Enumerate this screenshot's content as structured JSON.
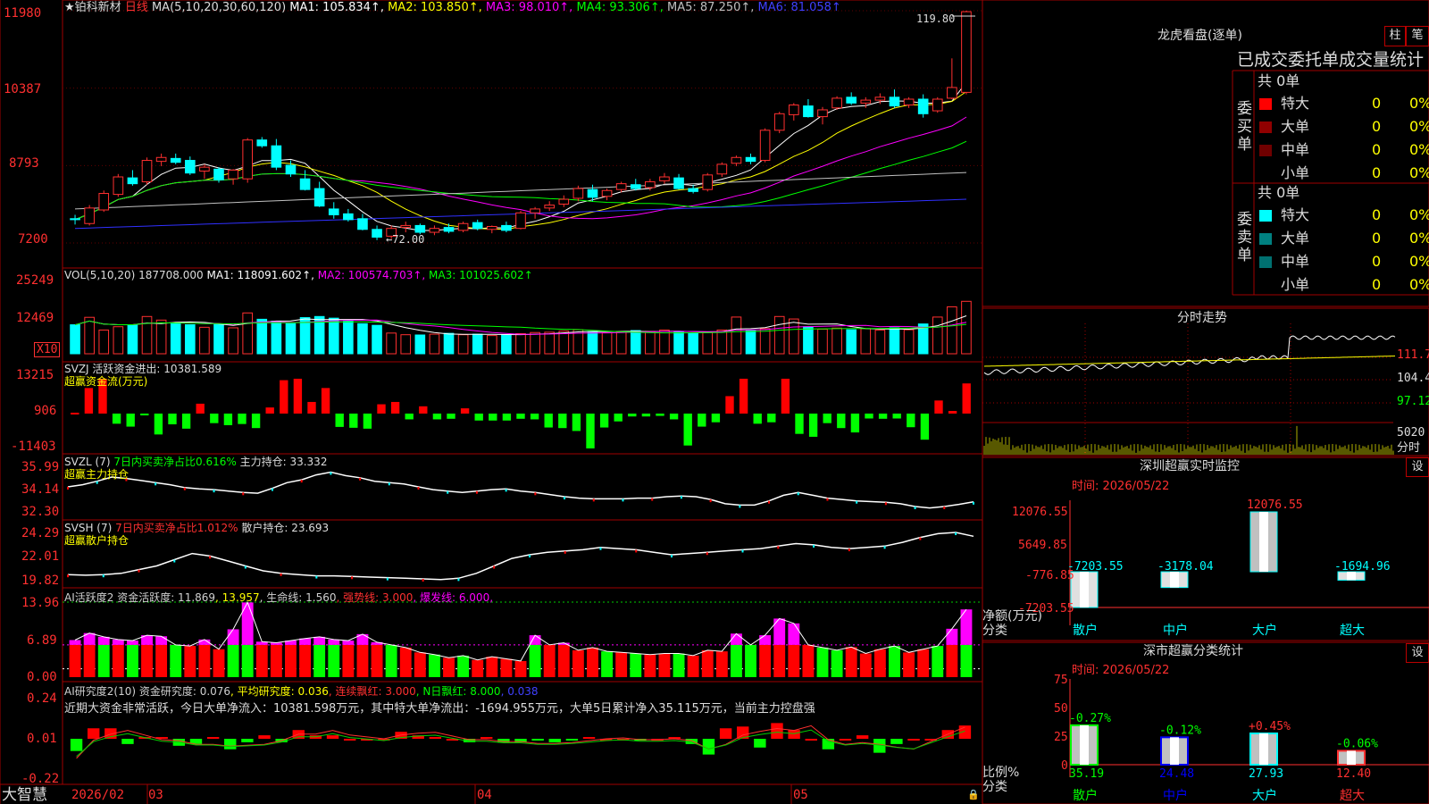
{
  "header": {
    "stock_name": "铂科新材",
    "period": "日线",
    "ma_label": "MA(5,10,20,30,60,120)",
    "ma_values": [
      {
        "text": "MA1: 105.834",
        "color": "#ffffff"
      },
      {
        "text": "MA2: 103.850",
        "color": "#ffff00"
      },
      {
        "text": "MA3: 98.010",
        "color": "#ff00ff"
      },
      {
        "text": "MA4: 93.306",
        "color": "#00ff00"
      },
      {
        "text": "MA5: 87.250",
        "color": "#c0c0c0"
      },
      {
        "text": "MA6: 81.058",
        "color": "#4040ff"
      }
    ],
    "high_marker": "119.80",
    "low_marker": "←72.00"
  },
  "price_axis": [
    "11980",
    "10387",
    "8793",
    "7200"
  ],
  "vol_panel": {
    "label": "VOL(5,10,20)",
    "value": "187708.000",
    "ma": [
      {
        "text": "MA1: 118091.602",
        "color": "#ffffff"
      },
      {
        "text": "MA2: 100574.703",
        "color": "#ff00ff"
      },
      {
        "text": "MA3: 101025.602",
        "color": "#00ff00"
      }
    ],
    "axis": [
      "25249",
      "12469"
    ],
    "unit": "X10"
  },
  "svzj_panel": {
    "label": "SVZJ  活跃资金进出: 10381.589",
    "sub": "超赢资金流(万元)",
    "axis": [
      "13215",
      "906",
      "-11403"
    ]
  },
  "svzl_panel": {
    "label": "SVZL (7)",
    "mid": "7日内买卖净占比0.616%",
    "right": "主力持仓: 33.332",
    "sub": "超赢主力持仓",
    "axis": [
      "35.99",
      "34.14",
      "32.30"
    ]
  },
  "svsh_panel": {
    "label": "SVSH (7)",
    "mid": "7日内买卖净占比1.012%",
    "right": "散户持仓: 23.693",
    "sub": "超赢散户持仓",
    "axis": [
      "24.29",
      "22.01",
      "19.82"
    ]
  },
  "ai_active_panel": {
    "parts": [
      {
        "text": "AI活跃度2 资金活跃度: 11.869",
        "color": "#d0d0d0"
      },
      {
        "text": ", 13.957",
        "color": "#ffff00"
      },
      {
        "text": ", 生命线: 1.560",
        "color": "#d0d0d0"
      },
      {
        "text": ", 强势线: 3.000",
        "color": "#ff3030"
      },
      {
        "text": ", 爆发线: 6.000,",
        "color": "#ff00ff"
      }
    ],
    "axis": [
      "13.96",
      "6.89",
      "0.00"
    ]
  },
  "ai_research_panel": {
    "parts": [
      {
        "text": "AI研究度2(10) 资金研究度: 0.076",
        "color": "#d0d0d0"
      },
      {
        "text": ", 平均研究度: 0.036",
        "color": "#ffff00"
      },
      {
        "text": ", 连续飘红: 3.000",
        "color": "#ff3030"
      },
      {
        "text": ", N日飘红: 8.000",
        "color": "#00ff00"
      },
      {
        "text": ", 0.038",
        "color": "#4040ff"
      }
    ],
    "comment": "近期大资金非常活跃，今日大单净流入：10381.598万元，其中特大单净流出：-1694.955万元，大单5日累计净入35.115万元，当前主力控盘强",
    "axis": [
      "0.24",
      "0.01",
      "-0.22"
    ]
  },
  "bottom_bar": {
    "brand": "大智慧",
    "dates": [
      "2026/02",
      "03",
      "04",
      "05"
    ]
  },
  "right_panel": {
    "title": "龙虎看盘(逐单)",
    "btn_a": "柱",
    "btn_b": "笔",
    "table_title": "已成交委托单成交量统计",
    "buy_side_label": "委买单",
    "sell_side_label": "委卖单",
    "buy_total": "共 0单",
    "sell_total": "共 0单",
    "buy_rows": [
      {
        "name": "特大",
        "count": "0",
        "pct": "0%",
        "color": "#ff0000"
      },
      {
        "name": "大单",
        "count": "0",
        "pct": "0%",
        "color": "#900000"
      },
      {
        "name": "中单",
        "count": "0",
        "pct": "0%",
        "color": "#700000"
      },
      {
        "name": "小单",
        "count": "0",
        "pct": "0%",
        "color": "#000000"
      }
    ],
    "sell_rows": [
      {
        "name": "特大",
        "count": "0",
        "pct": "0%",
        "color": "#00ffff"
      },
      {
        "name": "大单",
        "count": "0",
        "pct": "0%",
        "color": "#008080"
      },
      {
        "name": "中单",
        "count": "0",
        "pct": "0%",
        "color": "#007070"
      },
      {
        "name": "小单",
        "count": "0",
        "pct": "0%",
        "color": "#000000"
      }
    ],
    "intraday_title": "分时走势",
    "intraday_axis": [
      "111.7",
      "104.4",
      "97.12"
    ],
    "intraday_vol_axis": [
      "5020",
      "分时"
    ],
    "monitor_title": "深圳超赢实时监控",
    "monitor_btn": "设",
    "monitor_time": "时间: 2026/05/22",
    "monitor_axis": [
      "12076.55",
      "5649.85",
      "-776.85",
      "-7203.55"
    ],
    "monitor_ylabel": "净额(万元)",
    "monitor_xlabel": "分类",
    "class_title": "深市超赢分类统计",
    "class_btn": "设",
    "class_time": "时间: 2026/05/22",
    "class_axis": [
      "75",
      "50",
      "25",
      "0"
    ],
    "class_ylabel": "比例%",
    "class_xlabel": "分类"
  },
  "chart_data": [
    {
      "type": "candlestick",
      "title": "铂科新材 日线",
      "ylim": [
        7200,
        11980
      ],
      "note": "approximate daily OHLC values read from chart (price scale as shown on axis)",
      "ohlc": [
        [
          7700,
          7780,
          7580,
          7680
        ],
        [
          7600,
          7980,
          7560,
          7920
        ],
        [
          7880,
          8280,
          7840,
          8220
        ],
        [
          8200,
          8620,
          8150,
          8560
        ],
        [
          8540,
          8700,
          8380,
          8420
        ],
        [
          8460,
          8960,
          8400,
          8900
        ],
        [
          8880,
          9040,
          8780,
          8960
        ],
        [
          8940,
          9040,
          8820,
          8860
        ],
        [
          8900,
          8980,
          8600,
          8640
        ],
        [
          8680,
          8820,
          8520,
          8760
        ],
        [
          8720,
          8760,
          8440,
          8500
        ],
        [
          8520,
          8720,
          8400,
          8700
        ],
        [
          8520,
          9360,
          8440,
          9320
        ],
        [
          9320,
          9380,
          9160,
          9200
        ],
        [
          9200,
          9340,
          8700,
          8760
        ],
        [
          8800,
          8900,
          8560,
          8620
        ],
        [
          8520,
          8700,
          8280,
          8300
        ],
        [
          8320,
          8460,
          7940,
          7960
        ],
        [
          7900,
          8040,
          7700,
          7780
        ],
        [
          7800,
          7900,
          7640,
          7680
        ],
        [
          7700,
          7800,
          7460,
          7480
        ],
        [
          7480,
          7560,
          7260,
          7320
        ],
        [
          7340,
          7560,
          7280,
          7500
        ],
        [
          7520,
          7640,
          7420,
          7560
        ],
        [
          7560,
          7600,
          7380,
          7420
        ],
        [
          7420,
          7560,
          7360,
          7500
        ],
        [
          7520,
          7600,
          7400,
          7440
        ],
        [
          7460,
          7640,
          7420,
          7600
        ],
        [
          7620,
          7680,
          7460,
          7500
        ],
        [
          7480,
          7560,
          7400,
          7540
        ],
        [
          7560,
          7640,
          7420,
          7460
        ],
        [
          7500,
          7860,
          7480,
          7820
        ],
        [
          7820,
          7940,
          7700,
          7900
        ],
        [
          7920,
          8060,
          7860,
          7980
        ],
        [
          8000,
          8180,
          7940,
          8100
        ],
        [
          8120,
          8380,
          8060,
          8320
        ],
        [
          8300,
          8400,
          8060,
          8140
        ],
        [
          8160,
          8320,
          8080,
          8280
        ],
        [
          8300,
          8460,
          8240,
          8420
        ],
        [
          8400,
          8520,
          8280,
          8320
        ],
        [
          8340,
          8520,
          8280,
          8460
        ],
        [
          8480,
          8640,
          8420,
          8560
        ],
        [
          8540,
          8620,
          8300,
          8320
        ],
        [
          8320,
          8400,
          8220,
          8260
        ],
        [
          8300,
          8640,
          8260,
          8600
        ],
        [
          8620,
          8860,
          8560,
          8820
        ],
        [
          8840,
          9000,
          8780,
          8960
        ],
        [
          8960,
          9040,
          8820,
          8880
        ],
        [
          8900,
          9560,
          8860,
          9520
        ],
        [
          9520,
          9900,
          9460,
          9860
        ],
        [
          9840,
          10080,
          9720,
          10040
        ],
        [
          10020,
          10160,
          9780,
          9800
        ],
        [
          9800,
          10000,
          9640,
          9940
        ],
        [
          9980,
          10220,
          9940,
          10180
        ],
        [
          10200,
          10300,
          10040,
          10080
        ],
        [
          10080,
          10200,
          9980,
          10140
        ],
        [
          10140,
          10280,
          10060,
          10200
        ],
        [
          10200,
          10360,
          9980,
          10020
        ],
        [
          10040,
          10200,
          9980,
          10160
        ],
        [
          10160,
          10260,
          9780,
          9860
        ],
        [
          9920,
          10200,
          9880,
          10160
        ],
        [
          10180,
          11000,
          10160,
          10400
        ],
        [
          10300,
          11980,
          10260,
          11960
        ]
      ]
    },
    {
      "type": "bar",
      "title": "VOL(5,10,20)",
      "ylim": [
        0,
        25249
      ],
      "values": [
        10500,
        13200,
        8600,
        9800,
        10500,
        13500,
        12200,
        11000,
        10500,
        9600,
        10800,
        9400,
        14800,
        12500,
        11800,
        10900,
        13100,
        13500,
        12900,
        11800,
        10900,
        10300,
        7500,
        6900,
        6800,
        7100,
        7400,
        6900,
        7100,
        6600,
        6800,
        7300,
        7700,
        7800,
        8200,
        8700,
        8000,
        7600,
        7900,
        8400,
        8100,
        8600,
        7800,
        7400,
        7700,
        8600,
        13300,
        8500,
        9100,
        13500,
        12600,
        9800,
        8900,
        9300,
        8700,
        9100,
        8600,
        9400,
        8700,
        10800,
        13300,
        17000,
        19000
      ]
    },
    {
      "type": "bar",
      "title": "SVZJ 超赢资金流(万元)",
      "ylim": [
        -11403,
        13215
      ],
      "values": [
        300,
        8800,
        12000,
        -3500,
        -4500,
        -300,
        -7200,
        -3700,
        -5200,
        3400,
        -3300,
        -4000,
        -3600,
        -5000,
        2100,
        11500,
        12000,
        4000,
        8800,
        -4600,
        -4900,
        -5200,
        3200,
        4000,
        -2000,
        2500,
        -2000,
        -1800,
        1800,
        -2400,
        -2400,
        -2400,
        -1800,
        -2000,
        -4800,
        -5000,
        -6000,
        -12000,
        -4800,
        -2700,
        -1000,
        -1000,
        -800,
        -2000,
        -11000,
        -4500,
        -3000,
        6000,
        12000,
        -3500,
        -3000,
        12000,
        -7000,
        -8000,
        -3300,
        -5000,
        -6500,
        -1700,
        -1800,
        -1700,
        -4700,
        -9000,
        4500,
        900,
        10381
      ]
    },
    {
      "type": "line",
      "title": "SVZL 超赢主力持仓",
      "ylim": [
        32.3,
        35.99
      ],
      "values": [
        34.4,
        34.55,
        34.8,
        35.1,
        35.0,
        34.85,
        34.7,
        34.55,
        34.35,
        34.25,
        34.2,
        34.1,
        34.0,
        33.95,
        34.3,
        34.7,
        34.9,
        35.25,
        35.45,
        35.2,
        35.05,
        34.8,
        34.7,
        34.6,
        34.4,
        34.2,
        34.1,
        34.0,
        34.1,
        34.2,
        34.25,
        34.1,
        34.0,
        33.85,
        33.7,
        33.6,
        33.55,
        33.55,
        33.55,
        33.6,
        33.6,
        33.7,
        33.75,
        33.7,
        33.5,
        33.2,
        33.1,
        33.1,
        33.4,
        33.8,
        34.0,
        33.8,
        33.6,
        33.5,
        33.4,
        33.35,
        33.3,
        33.2,
        33.0,
        32.9,
        33.0,
        33.15,
        33.33
      ]
    },
    {
      "type": "line",
      "title": "SVSH 超赢散户持仓",
      "ylim": [
        19.82,
        24.29
      ],
      "values": [
        20.6,
        20.55,
        20.6,
        20.7,
        21.0,
        21.3,
        21.8,
        22.3,
        22.1,
        21.7,
        21.3,
        20.9,
        20.7,
        20.6,
        20.5,
        20.5,
        20.45,
        20.4,
        20.35,
        20.3,
        20.25,
        20.2,
        20.3,
        20.7,
        21.3,
        21.9,
        22.2,
        22.4,
        22.5,
        22.6,
        22.8,
        22.7,
        22.6,
        22.4,
        22.2,
        22.3,
        22.4,
        22.5,
        22.6,
        22.7,
        22.9,
        23.1,
        23.0,
        22.8,
        22.7,
        22.8,
        22.9,
        23.2,
        23.6,
        23.9,
        24.0,
        23.69
      ]
    },
    {
      "type": "bar",
      "title": "AI活跃度2",
      "ylim": [
        0,
        13.96
      ],
      "values": [
        6.9,
        8.2,
        7.5,
        7.0,
        6.8,
        7.8,
        7.6,
        6.0,
        5.8,
        7.0,
        5.2,
        8.9,
        13.9,
        6.6,
        6.4,
        6.8,
        7.2,
        7.5,
        7.0,
        6.8,
        8.0,
        6.5,
        6.0,
        5.5,
        4.6,
        4.2,
        3.6,
        4.0,
        3.2,
        3.8,
        3.4,
        3.0,
        7.8,
        6.0,
        6.4,
        5.0,
        5.5,
        4.8,
        4.6,
        4.4,
        4.2,
        4.4,
        4.4,
        4.0,
        5.0,
        4.8,
        8.1,
        6.0,
        7.8,
        10.9,
        10.0,
        6.0,
        5.5,
        5.0,
        5.6,
        4.4,
        5.2,
        5.8,
        4.6,
        5.2,
        5.8,
        9.0,
        12.6
      ]
    },
    {
      "type": "bar",
      "title": "AI研究度2(10)",
      "ylim": [
        -0.22,
        0.24
      ],
      "values": [
        -0.07,
        0.06,
        0.06,
        -0.03,
        0.01,
        0.01,
        -0.04,
        -0.03,
        0.01,
        -0.06,
        -0.02,
        0.02,
        -0.02,
        0.05,
        0.02,
        0.02,
        0.0,
        0.0,
        0.0,
        0.04,
        0.02,
        0.01,
        0.0,
        -0.02,
        0.01,
        -0.02,
        -0.02,
        -0.01,
        -0.02,
        -0.01,
        0.01,
        0.0,
        0.0,
        -0.01,
        0.0,
        0.01,
        -0.03,
        -0.09,
        0.06,
        0.07,
        -0.05,
        0.09,
        0.05,
        0.0,
        -0.06,
        0.0,
        0.02,
        -0.08,
        -0.03,
        0.0,
        0.0,
        0.05,
        0.076
      ]
    },
    {
      "type": "bar",
      "title": "深圳超赢实时监控",
      "ylim": [
        -7203.55,
        12076.55
      ],
      "categories": [
        "散户",
        "中户",
        "大户",
        "超大"
      ],
      "values": [
        -7203.55,
        -3178.04,
        12076.55,
        -1694.96
      ]
    },
    {
      "type": "bar",
      "title": "深市超赢分类统计",
      "ylim": [
        0,
        75
      ],
      "categories": [
        "散户",
        "中户",
        "大户",
        "超大"
      ],
      "values": [
        35.19,
        24.48,
        27.93,
        12.4
      ],
      "changes": [
        "-0.27%",
        "-0.12%",
        "+0.45%",
        "-0.06%"
      ]
    }
  ]
}
